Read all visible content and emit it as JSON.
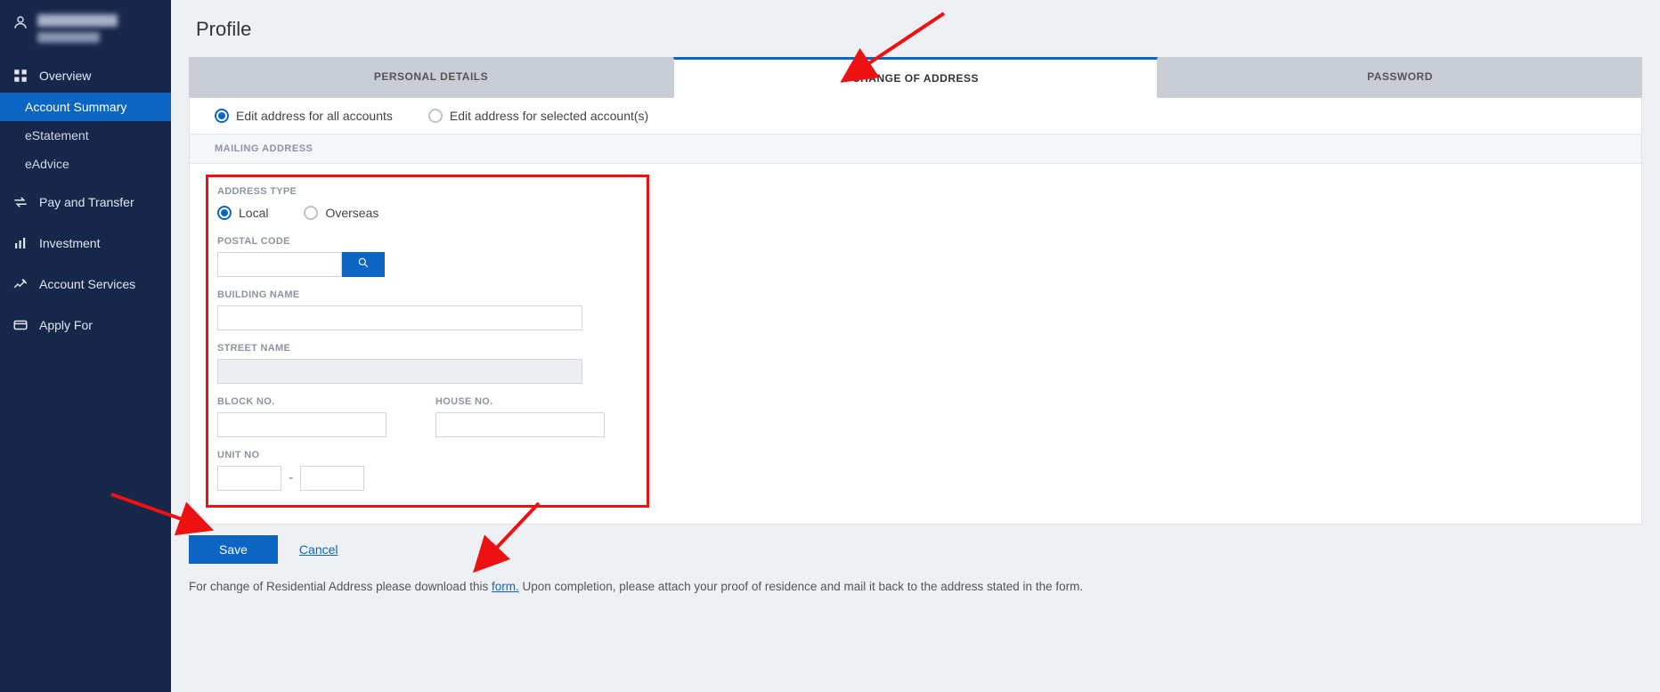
{
  "page": {
    "title": "Profile"
  },
  "sidebar": {
    "items": [
      {
        "label": "Overview",
        "icon": "overview"
      },
      {
        "label": "Pay and Transfer",
        "icon": "transfer"
      },
      {
        "label": "Investment",
        "icon": "investment"
      },
      {
        "label": "Account Services",
        "icon": "services"
      },
      {
        "label": "Apply For",
        "icon": "apply"
      }
    ],
    "overview_subitems": [
      {
        "label": "Account Summary",
        "selected": true
      },
      {
        "label": "eStatement",
        "selected": false
      },
      {
        "label": "eAdvice",
        "selected": false
      }
    ]
  },
  "tabs": [
    {
      "label": "PERSONAL DETAILS",
      "active": false
    },
    {
      "label": "CHANGE OF ADDRESS",
      "active": true
    },
    {
      "label": "PASSWORD",
      "active": false
    }
  ],
  "edit_scope": {
    "all_label": "Edit address for all accounts",
    "selected_label": "Edit address for selected account(s)",
    "value": "all"
  },
  "section_labels": {
    "mailing": "MAILING ADDRESS"
  },
  "address_form": {
    "type_label": "ADDRESS TYPE",
    "type_options": {
      "local": "Local",
      "overseas": "Overseas"
    },
    "type_value": "local",
    "postal_label": "POSTAL CODE",
    "postal_value": "",
    "building_label": "BUILDING NAME",
    "building_value": "",
    "street_label": "STREET NAME",
    "street_value": "",
    "block_label": "BLOCK NO.",
    "block_value": "",
    "house_label": "HOUSE NO.",
    "house_value": "",
    "unit_label": "UNIT NO",
    "unit_a": "",
    "unit_b": "",
    "unit_sep": "-"
  },
  "buttons": {
    "save": "Save",
    "cancel": "Cancel"
  },
  "footnote": {
    "before": "For change of Residential Address please download this ",
    "link": "form.",
    "after": " Upon completion, please attach your proof of residence and mail it back to the address stated in the form."
  }
}
